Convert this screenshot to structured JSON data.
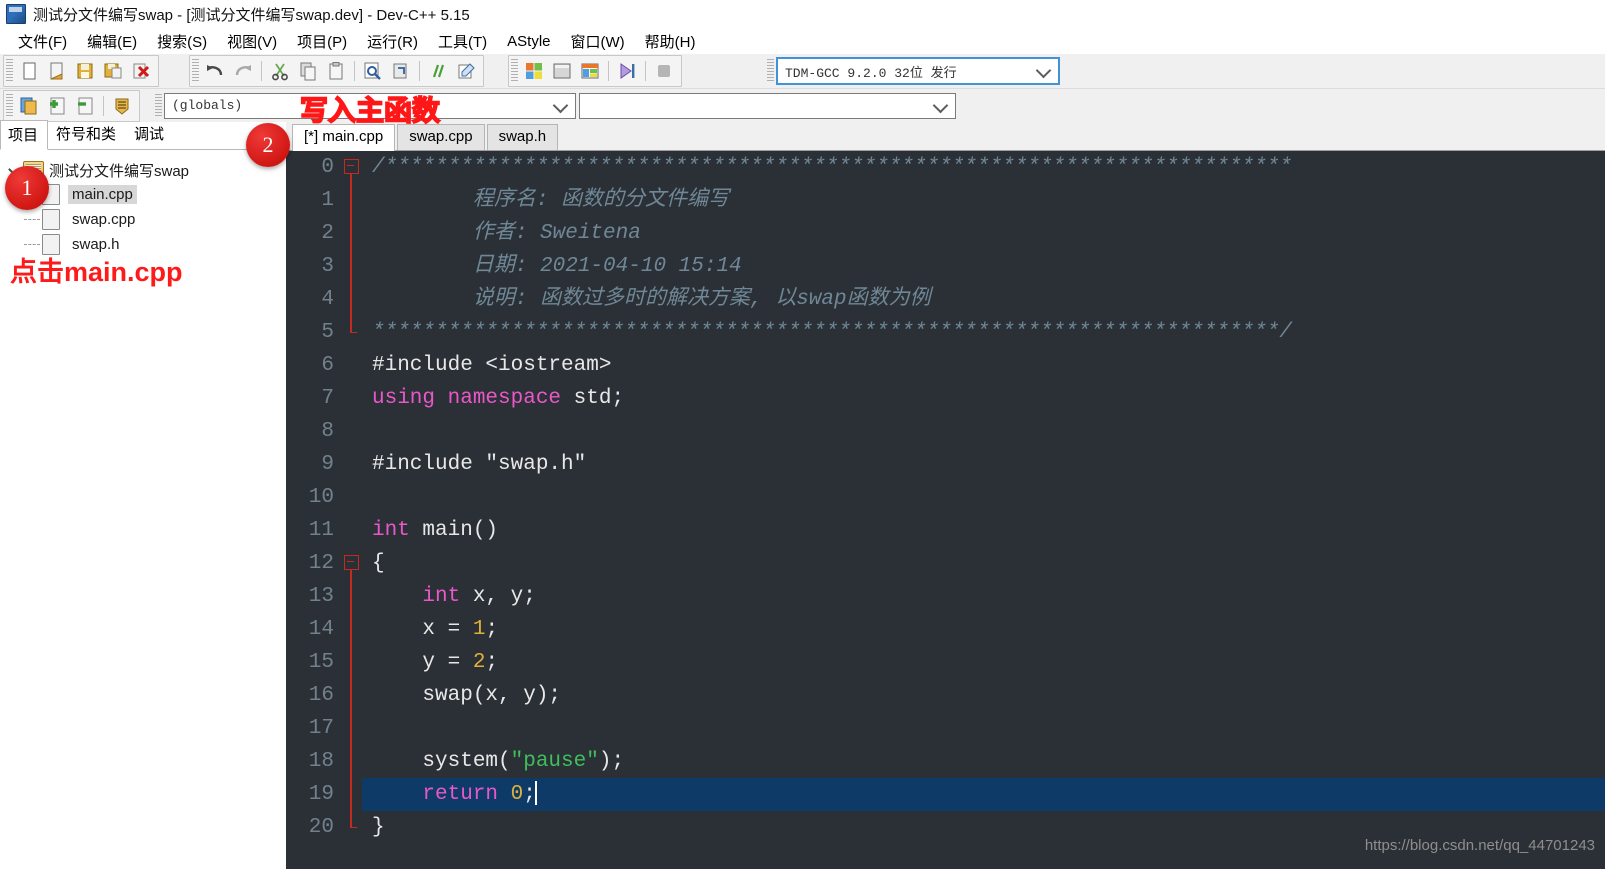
{
  "window": {
    "title": "测试分文件编写swap - [测试分文件编写swap.dev] - Dev-C++ 5.15",
    "icon": "dev-cpp-icon"
  },
  "menubar": {
    "items": [
      {
        "label": "文件(F)",
        "name": "menu-file"
      },
      {
        "label": "编辑(E)",
        "name": "menu-edit"
      },
      {
        "label": "搜索(S)",
        "name": "menu-search"
      },
      {
        "label": "视图(V)",
        "name": "menu-view"
      },
      {
        "label": "项目(P)",
        "name": "menu-project"
      },
      {
        "label": "运行(R)",
        "name": "menu-run"
      },
      {
        "label": "工具(T)",
        "name": "menu-tools"
      },
      {
        "label": "AStyle",
        "name": "menu-astyle"
      },
      {
        "label": "窗口(W)",
        "name": "menu-window"
      },
      {
        "label": "帮助(H)",
        "name": "menu-help"
      }
    ]
  },
  "toolbar": {
    "compiler_combo": {
      "value": "TDM-GCC 9.2.0 32位 发行",
      "name": "compiler-select"
    },
    "scope_combo": {
      "value": "(globals)",
      "name": "scope-select"
    },
    "member_combo": {
      "value": "",
      "name": "member-select"
    }
  },
  "left_panel": {
    "tabs": [
      {
        "label": "项目",
        "name": "tab-project",
        "active": true
      },
      {
        "label": "符号和类",
        "name": "tab-classes",
        "active": false
      },
      {
        "label": "调试",
        "name": "tab-debug",
        "active": false
      }
    ],
    "tree": {
      "root": "测试分文件编写swap",
      "children": [
        {
          "label": "main.cpp",
          "selected": true
        },
        {
          "label": "swap.cpp",
          "selected": false
        },
        {
          "label": "swap.h",
          "selected": false
        }
      ]
    }
  },
  "editor": {
    "tabs": [
      {
        "label": "[*] main.cpp",
        "name": "editor-tab-main-cpp",
        "active": true
      },
      {
        "label": "swap.cpp",
        "name": "editor-tab-swap-cpp",
        "active": false
      },
      {
        "label": "swap.h",
        "name": "editor-tab-swap-h",
        "active": false
      }
    ],
    "active_line": 19,
    "lines": [
      {
        "n": "0",
        "fold": "start",
        "tokens": [
          {
            "t": "/************************************************************************",
            "c": "c-comment"
          }
        ]
      },
      {
        "n": "1",
        "fold": "line",
        "tokens": [
          {
            "t": "        程序名: 函数的分文件编写",
            "c": "c-comment"
          }
        ]
      },
      {
        "n": "2",
        "fold": "line",
        "tokens": [
          {
            "t": "        作者: Sweitena",
            "c": "c-comment"
          }
        ]
      },
      {
        "n": "3",
        "fold": "line",
        "tokens": [
          {
            "t": "        日期: 2021-04-10 15:14",
            "c": "c-comment"
          }
        ]
      },
      {
        "n": "4",
        "fold": "line",
        "tokens": [
          {
            "t": "        说明: 函数过多时的解决方案, 以swap函数为例",
            "c": "c-comment"
          }
        ]
      },
      {
        "n": "5",
        "fold": "end",
        "tokens": [
          {
            "t": "************************************************************************/",
            "c": "c-comment"
          }
        ]
      },
      {
        "n": "6",
        "fold": "",
        "tokens": [
          {
            "t": "#include <iostream>",
            "c": "c-pre"
          }
        ]
      },
      {
        "n": "7",
        "fold": "",
        "tokens": [
          {
            "t": "using namespace",
            "c": "c-kw"
          },
          {
            "t": " std;",
            "c": "c-plain"
          }
        ]
      },
      {
        "n": "8",
        "fold": "",
        "tokens": []
      },
      {
        "n": "9",
        "fold": "",
        "tokens": [
          {
            "t": "#include \"swap.h\"",
            "c": "c-pre"
          }
        ]
      },
      {
        "n": "10",
        "fold": "",
        "tokens": []
      },
      {
        "n": "11",
        "fold": "",
        "tokens": [
          {
            "t": "int",
            "c": "c-kw"
          },
          {
            "t": " main()",
            "c": "c-plain"
          }
        ]
      },
      {
        "n": "12",
        "fold": "start",
        "tokens": [
          {
            "t": "{",
            "c": "c-plain"
          }
        ]
      },
      {
        "n": "13",
        "fold": "line",
        "tokens": [
          {
            "t": "    ",
            "c": "c-plain"
          },
          {
            "t": "int",
            "c": "c-kw"
          },
          {
            "t": " x, y;",
            "c": "c-plain"
          }
        ]
      },
      {
        "n": "14",
        "fold": "line",
        "tokens": [
          {
            "t": "    x = ",
            "c": "c-plain"
          },
          {
            "t": "1",
            "c": "c-num"
          },
          {
            "t": ";",
            "c": "c-plain"
          }
        ]
      },
      {
        "n": "15",
        "fold": "line",
        "tokens": [
          {
            "t": "    y = ",
            "c": "c-plain"
          },
          {
            "t": "2",
            "c": "c-num"
          },
          {
            "t": ";",
            "c": "c-plain"
          }
        ]
      },
      {
        "n": "16",
        "fold": "line",
        "tokens": [
          {
            "t": "    swap(x, y);",
            "c": "c-plain"
          }
        ]
      },
      {
        "n": "17",
        "fold": "line",
        "tokens": []
      },
      {
        "n": "18",
        "fold": "line",
        "tokens": [
          {
            "t": "    system(",
            "c": "c-plain"
          },
          {
            "t": "\"pause\"",
            "c": "c-str"
          },
          {
            "t": ");",
            "c": "c-plain"
          }
        ]
      },
      {
        "n": "19",
        "fold": "line",
        "tokens": [
          {
            "t": "    ",
            "c": "c-plain"
          },
          {
            "t": "return",
            "c": "c-kw"
          },
          {
            "t": " ",
            "c": "c-plain"
          },
          {
            "t": "0",
            "c": "c-num"
          },
          {
            "t": ";",
            "c": "c-plain"
          }
        ],
        "caret": true
      },
      {
        "n": "20",
        "fold": "end",
        "tokens": [
          {
            "t": "}",
            "c": "c-plain"
          }
        ]
      }
    ]
  },
  "annotations": {
    "badge1": "1",
    "badge2": "2",
    "click_main": "点击main.cpp",
    "write_main_func": "写入主函数"
  },
  "watermark": "https://blog.csdn.net/qq_44701243",
  "colors": {
    "editor_bg": "#2b3036",
    "active_line": "#0d3a66",
    "keyword": "#e957c8",
    "string": "#3fbf5c",
    "number": "#e0b13a",
    "comment": "#6f8796",
    "annotation_red": "#ff1616"
  }
}
